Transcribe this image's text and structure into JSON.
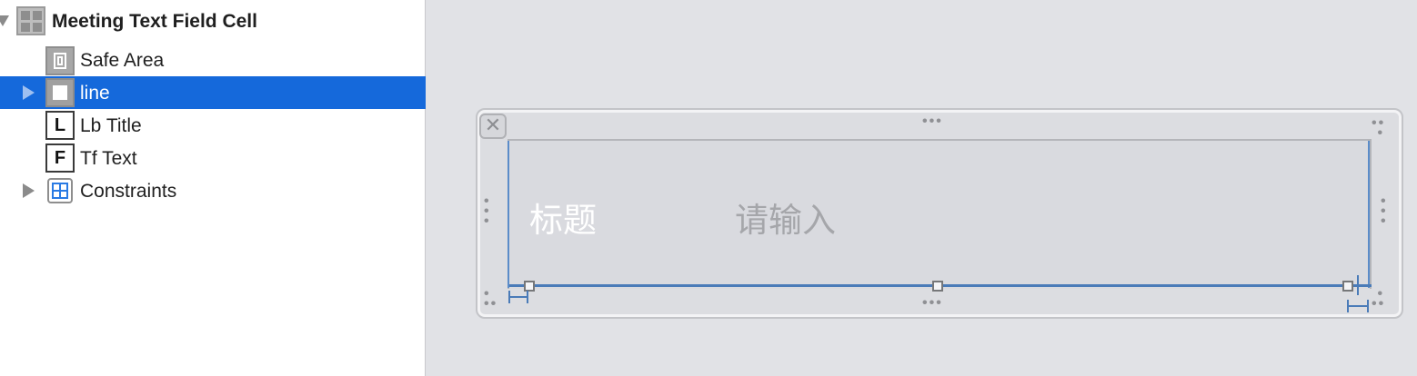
{
  "outline": {
    "root": {
      "label": "Meeting Text Field Cell",
      "icon": "view-grid-icon"
    },
    "items": [
      {
        "label": "Safe Area",
        "icon": "safe-area-icon",
        "badge": ""
      },
      {
        "label": "line",
        "icon": "view-icon",
        "badge": "",
        "selected": true
      },
      {
        "label": "Lb Title",
        "icon": "label-icon",
        "badge": "L"
      },
      {
        "label": "Tf Text",
        "icon": "textfield-icon",
        "badge": "F"
      },
      {
        "label": "Constraints",
        "icon": "constraints-icon",
        "badge": ""
      }
    ]
  },
  "canvas": {
    "close_glyph": "✕",
    "title_text": "标题",
    "placeholder_text": "请输入"
  },
  "colors": {
    "selection": "#1569db",
    "constraint": "#4a7bb8"
  }
}
